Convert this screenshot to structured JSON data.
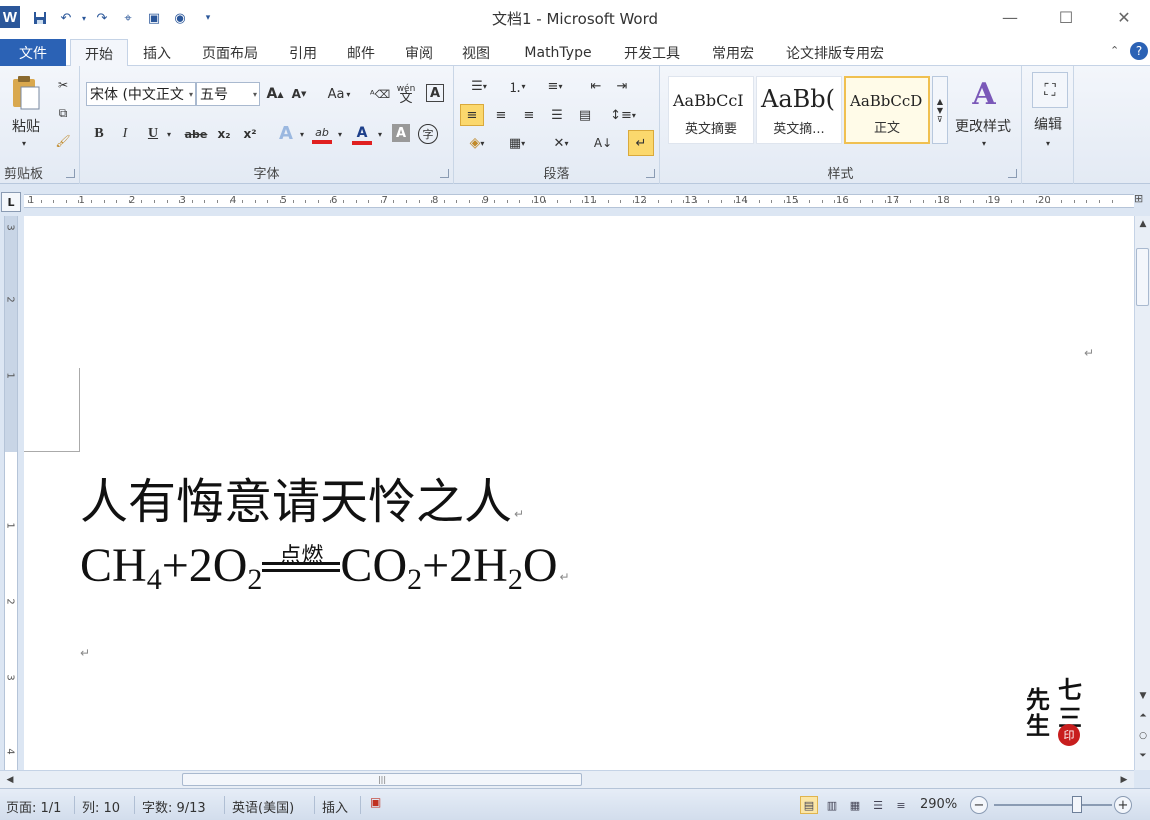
{
  "window": {
    "title": "文档1 - Microsoft Word",
    "app_icon_letter": "W",
    "minimize": "—",
    "maximize": "☐",
    "close": "✕"
  },
  "quick_access": [
    "save-icon",
    "undo-icon",
    "redo-icon",
    "format-painter-icon",
    "print-preview-icon",
    "help-circle-icon"
  ],
  "tabs": {
    "file": "文件",
    "items": [
      "开始",
      "插入",
      "页面布局",
      "引用",
      "邮件",
      "审阅",
      "视图",
      "MathType",
      "开发工具",
      "常用宏",
      "论文排版专用宏"
    ],
    "active": "开始"
  },
  "ribbon": {
    "clipboard": {
      "paste": "粘贴",
      "label": "剪贴板"
    },
    "font": {
      "label": "字体",
      "font_name": "宋体 (中文正文",
      "font_size": "五号",
      "bold": "B",
      "italic": "I",
      "underline": "U",
      "strike": "abe",
      "subscript": "x₂",
      "superscript": "x²",
      "grow": "A",
      "shrink": "A",
      "case": "Aa",
      "font_color": "A",
      "highlight": "ab",
      "char_shading": "A",
      "enclose": "字",
      "pinyin": "wén",
      "clear": "A"
    },
    "paragraph": {
      "label": "段落"
    },
    "styles": {
      "label": "样式",
      "items": [
        {
          "sample": "AaBbCcI",
          "name": "英文摘要"
        },
        {
          "sample": "AaBb(",
          "name": "英文摘..."
        },
        {
          "sample": "AaBbCcD",
          "name": "正文"
        }
      ],
      "selected": "正文",
      "change_styles": "更改样式"
    },
    "editing": {
      "label": "编辑"
    }
  },
  "ruler": {
    "corner": "L",
    "numbers": [
      "1",
      "1",
      "2",
      "3",
      "4",
      "5",
      "6",
      "7",
      "8",
      "9",
      "10",
      "11",
      "12",
      "13",
      "14",
      "15",
      "16",
      "17",
      "18",
      "19",
      "20"
    ],
    "vertical_numbers": [
      "3",
      "2",
      "1",
      "1",
      "2",
      "3",
      "4"
    ]
  },
  "document": {
    "line1": "人有悔意请天怜之人",
    "equation": {
      "ch": "CH",
      "four": "4",
      "plus2o": "+2O",
      "two_a": "2",
      "condition": "点燃",
      "co": "CO",
      "two_b": "2",
      "plus2h": "+2H",
      "two_c": "2",
      "o": "O"
    },
    "paragraph_mark": "↵",
    "seal": {
      "c1": "七",
      "c2": "先",
      "c3": "三",
      "c4": "生",
      "stamp": "印"
    }
  },
  "status": {
    "page": "页面: 1/1",
    "column": "列: 10",
    "words": "字数: 9/13",
    "language": "英语(美国)",
    "mode": "插入",
    "zoom": "290%",
    "zoom_minus": "−",
    "zoom_plus": "+"
  },
  "colors": {
    "accent": "#2b62b5",
    "highlight_yellow": "#ffff00",
    "font_red": "#e02020"
  }
}
